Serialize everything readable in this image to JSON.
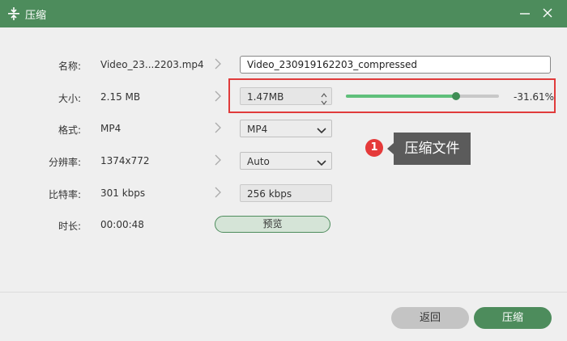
{
  "window": {
    "title": "压缩",
    "accent_color": "#4d8c5c"
  },
  "rows": {
    "name": {
      "label": "名称:",
      "value": "Video_23...2203.mp4",
      "output": "Video_230919162203_compressed"
    },
    "size": {
      "label": "大小:",
      "value": "2.15 MB",
      "output": "1.47MB",
      "percent_text": "-31.61%",
      "slider_fraction": 0.72
    },
    "format": {
      "label": "格式:",
      "value": "MP4",
      "output": "MP4"
    },
    "resolution": {
      "label": "分辨率:",
      "value": "1374x772",
      "output": "Auto"
    },
    "bitrate": {
      "label": "比特率:",
      "value": "301 kbps",
      "output": "256 kbps"
    },
    "duration": {
      "label": "时长:",
      "value": "00:00:48"
    }
  },
  "preview_label": "预览",
  "annotation": {
    "badge": "1",
    "text": "压缩文件",
    "highlight_color": "#e03b3b"
  },
  "footer": {
    "back_label": "返回",
    "compress_label": "压缩"
  }
}
